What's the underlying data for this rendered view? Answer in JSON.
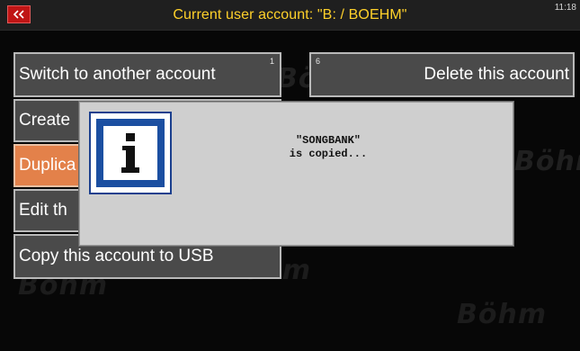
{
  "header": {
    "back_icon": "double-chevron-left-icon",
    "title": "Current user account: \"B: / BOEHM\"",
    "clock": "11:18"
  },
  "colors": {
    "title": "#ffd12a",
    "back_button": "#c01515",
    "button_bg": "#4a4a4a",
    "button_active": "#e3814a"
  },
  "watermark": {
    "brand": "Böhm"
  },
  "buttons": {
    "switch_account": {
      "label": "Switch to another account",
      "number": "1"
    },
    "delete_account": {
      "label": "Delete this account",
      "number": "6"
    },
    "create": {
      "label": "Create"
    },
    "duplicate": {
      "label": "Duplica"
    },
    "edit": {
      "label": "Edit th"
    },
    "copy_usb": {
      "label": "Copy this account to USB"
    }
  },
  "dialog": {
    "icon": "info-icon",
    "line1": "\"SONGBANK\"",
    "line2": "is copied..."
  }
}
